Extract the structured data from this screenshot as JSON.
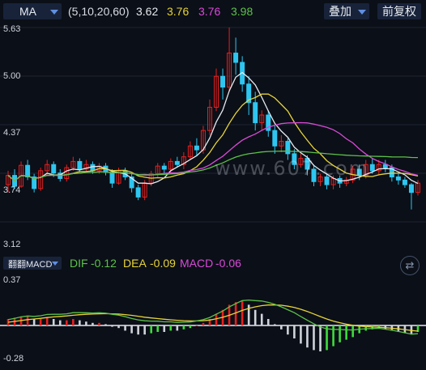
{
  "toolbar": {
    "indicator": "MA",
    "params": "(5,10,20,60)",
    "ma_values": [
      {
        "value": "3.62",
        "color": "#e6e9ef"
      },
      {
        "value": "3.76",
        "color": "#e7d33a"
      },
      {
        "value": "3.76",
        "color": "#d84ad8"
      },
      {
        "value": "3.98",
        "color": "#5cc24a"
      }
    ],
    "overlay_button": "叠加",
    "adjust_button": "前复权"
  },
  "price_axis": {
    "labels": [
      "5.63",
      "5.00",
      "4.37",
      "3.74",
      "3.12"
    ]
  },
  "watermark": "www.607.com",
  "macd_panel": {
    "indicator": "翻翻MACD",
    "dif_label": "DIF",
    "dif_value": "-0.12",
    "dea_label": "DEA",
    "dea_value": "-0.09",
    "macd_label": "MACD",
    "macd_value": "-0.06",
    "axis_top": "0.37",
    "axis_bottom": "-0.28",
    "colors": {
      "dif": "#5cc24a",
      "dea": "#e7d33a",
      "macd": "#d84ad8",
      "up": "#e62020",
      "down": "#3ddc3d"
    }
  },
  "chart_data": [
    {
      "type": "candlestick",
      "ylim": [
        3.12,
        5.63
      ],
      "candles": [
        [
          3.6,
          3.72,
          3.5,
          3.78
        ],
        [
          3.72,
          3.58,
          3.54,
          3.8
        ],
        [
          3.58,
          3.85,
          3.56,
          3.9
        ],
        [
          3.85,
          3.7,
          3.66,
          3.92
        ],
        [
          3.7,
          3.55,
          3.5,
          3.74
        ],
        [
          3.55,
          3.78,
          3.52,
          3.82
        ],
        [
          3.78,
          3.86,
          3.72,
          3.92
        ],
        [
          3.86,
          3.75,
          3.7,
          3.9
        ],
        [
          3.75,
          3.68,
          3.64,
          3.8
        ],
        [
          3.68,
          3.82,
          3.64,
          3.86
        ],
        [
          3.82,
          3.9,
          3.78,
          3.96
        ],
        [
          3.9,
          3.8,
          3.76,
          3.94
        ],
        [
          3.8,
          3.86,
          3.76,
          3.92
        ],
        [
          3.86,
          3.78,
          3.74,
          3.9
        ],
        [
          3.78,
          3.84,
          3.74,
          3.88
        ],
        [
          3.84,
          3.76,
          3.72,
          3.88
        ],
        [
          3.76,
          3.62,
          3.56,
          3.8
        ],
        [
          3.62,
          3.78,
          3.6,
          3.82
        ],
        [
          3.78,
          3.7,
          3.66,
          3.82
        ],
        [
          3.7,
          3.56,
          3.5,
          3.74
        ],
        [
          3.56,
          3.44,
          3.4,
          3.6
        ],
        [
          3.44,
          3.62,
          3.4,
          3.66
        ],
        [
          3.62,
          3.74,
          3.58,
          3.78
        ],
        [
          3.74,
          3.84,
          3.7,
          3.88
        ],
        [
          3.84,
          3.8,
          3.74,
          3.88
        ],
        [
          3.8,
          3.9,
          3.76,
          3.94
        ],
        [
          3.9,
          3.86,
          3.82,
          3.96
        ],
        [
          3.86,
          3.96,
          3.8,
          4.02
        ],
        [
          3.96,
          4.1,
          3.92,
          4.16
        ],
        [
          4.1,
          4.05,
          3.98,
          4.2
        ],
        [
          4.05,
          4.3,
          4.0,
          4.36
        ],
        [
          4.3,
          4.6,
          4.24,
          4.7
        ],
        [
          4.6,
          5.0,
          4.55,
          5.1
        ],
        [
          5.0,
          4.86,
          4.7,
          5.1
        ],
        [
          4.86,
          5.3,
          4.8,
          5.63
        ],
        [
          5.3,
          5.18,
          5.02,
          5.5
        ],
        [
          5.18,
          4.9,
          4.8,
          5.26
        ],
        [
          4.9,
          4.66,
          4.5,
          5.0
        ],
        [
          4.66,
          4.4,
          4.3,
          4.8
        ],
        [
          4.4,
          4.5,
          4.3,
          4.56
        ],
        [
          4.5,
          4.3,
          4.22,
          4.56
        ],
        [
          4.3,
          4.1,
          4.0,
          4.36
        ],
        [
          4.1,
          4.16,
          4.02,
          4.24
        ],
        [
          4.16,
          4.0,
          3.92,
          4.2
        ],
        [
          4.0,
          3.86,
          3.8,
          4.06
        ],
        [
          3.86,
          3.94,
          3.82,
          4.0
        ],
        [
          3.94,
          3.8,
          3.72,
          3.98
        ],
        [
          3.8,
          3.64,
          3.58,
          3.86
        ],
        [
          3.64,
          3.7,
          3.58,
          3.74
        ],
        [
          3.7,
          3.6,
          3.54,
          3.74
        ],
        [
          3.6,
          3.68,
          3.54,
          3.72
        ],
        [
          3.68,
          3.62,
          3.56,
          3.72
        ],
        [
          3.62,
          3.66,
          3.58,
          3.7
        ],
        [
          3.66,
          3.8,
          3.62,
          3.84
        ],
        [
          3.8,
          3.72,
          3.66,
          3.86
        ],
        [
          3.72,
          3.86,
          3.68,
          3.92
        ],
        [
          3.86,
          3.78,
          3.74,
          3.94
        ],
        [
          3.78,
          3.86,
          3.72,
          3.92
        ],
        [
          3.86,
          3.82,
          3.76,
          3.92
        ],
        [
          3.82,
          3.7,
          3.64,
          3.86
        ],
        [
          3.7,
          3.66,
          3.6,
          3.74
        ],
        [
          3.66,
          3.6,
          3.56,
          3.7
        ],
        [
          3.6,
          3.5,
          3.28,
          3.62
        ],
        [
          3.5,
          3.62,
          3.46,
          3.66
        ]
      ]
    },
    {
      "type": "bar",
      "values": [
        0.05,
        0.06,
        0.07,
        0.07,
        0.05,
        0.05,
        0.06,
        0.05,
        0.04,
        0.04,
        0.05,
        0.04,
        0.03,
        0.02,
        0.02,
        0.01,
        -0.01,
        -0.02,
        -0.04,
        -0.06,
        -0.07,
        -0.07,
        -0.06,
        -0.05,
        -0.05,
        -0.04,
        -0.04,
        -0.03,
        -0.02,
        0.0,
        0.02,
        0.05,
        0.09,
        0.12,
        0.16,
        0.18,
        0.19,
        0.16,
        0.12,
        0.09,
        0.05,
        0.01,
        -0.03,
        -0.07,
        -0.1,
        -0.14,
        -0.17,
        -0.19,
        -0.2,
        -0.19,
        -0.16,
        -0.13,
        -0.11,
        -0.09,
        -0.06,
        -0.04,
        -0.03,
        -0.02,
        -0.03,
        -0.04,
        -0.05,
        -0.06,
        -0.07,
        -0.05
      ]
    }
  ]
}
